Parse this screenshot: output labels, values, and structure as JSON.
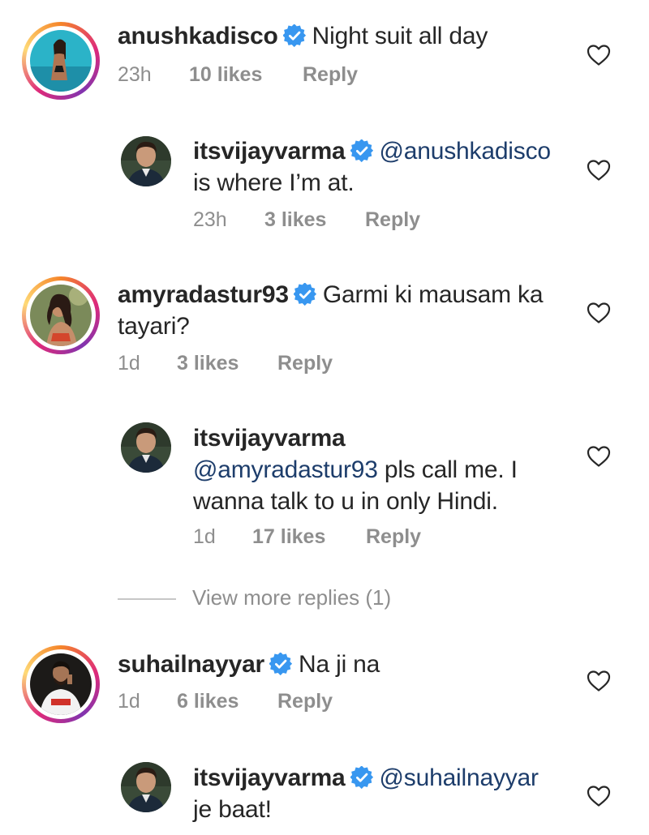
{
  "comments": [
    {
      "user": "anushkadisco",
      "text": "Night suit all day",
      "time": "23h",
      "likes": "10 likes",
      "reply": "Reply"
    },
    {
      "user": "itsvijayvarma",
      "mention": "@anushkadisco",
      "text": "is where I’m at.",
      "time": "23h",
      "likes": "3 likes",
      "reply": "Reply"
    },
    {
      "user": "amyradastur93",
      "text_line1": "Garmi ki mausam ka",
      "text_line2": "tayari?",
      "time": "1d",
      "likes": "3 likes",
      "reply": "Reply"
    },
    {
      "user": "itsvijayvarma",
      "mention": "@amyradastur93",
      "text_line1": " pls call me. I",
      "text_line2": "wanna talk to u in only Hindi.",
      "time": "1d",
      "likes": "17 likes",
      "reply": "Reply"
    },
    {
      "user": "suhailnayyar",
      "text": "Na ji na",
      "time": "1d",
      "likes": "6 likes",
      "reply": "Reply"
    },
    {
      "user": "itsvijayvarma",
      "mention": "@suhailnayyar",
      "text": "je baat!"
    }
  ],
  "view_more": "View more replies (1)",
  "icons": {
    "verified": "verified-badge-icon",
    "like": "heart-outline-icon"
  },
  "colors": {
    "verified_blue": "#3897f0",
    "mention": "#1d3d6b",
    "meta": "#8e8e8e"
  }
}
